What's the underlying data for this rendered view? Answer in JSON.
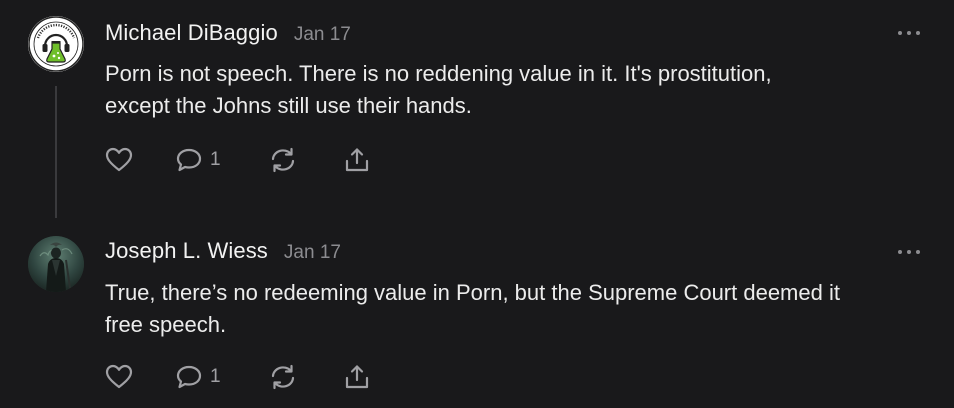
{
  "comments": [
    {
      "author": "Michael DiBaggio",
      "date": "Jan 17",
      "avatar_icon": "lab-flask-headphones-logo",
      "text_lines": [
        "Porn is not speech. There is no reddening value in it. It's prostitution,",
        "except the Johns still use their hands."
      ],
      "reply_count": "1"
    },
    {
      "author": "Joseph L. Wiess",
      "date": "Jan 17",
      "avatar_icon": "dark-figure-portrait",
      "text_lines": [
        "True, there’s no redeeming value in Porn, but the Supreme Court deemed it",
        "free speech."
      ],
      "reply_count": "1"
    }
  ],
  "icons": {
    "like": "heart-icon",
    "reply": "speech-bubble-icon",
    "restack": "refresh-arrows-icon",
    "share": "share-upload-icon",
    "more": "more-dots-icon"
  },
  "colors": {
    "background": "#19191b",
    "text": "#ececec",
    "muted": "#8c8c90",
    "logo_green": "#6fbf2a"
  }
}
